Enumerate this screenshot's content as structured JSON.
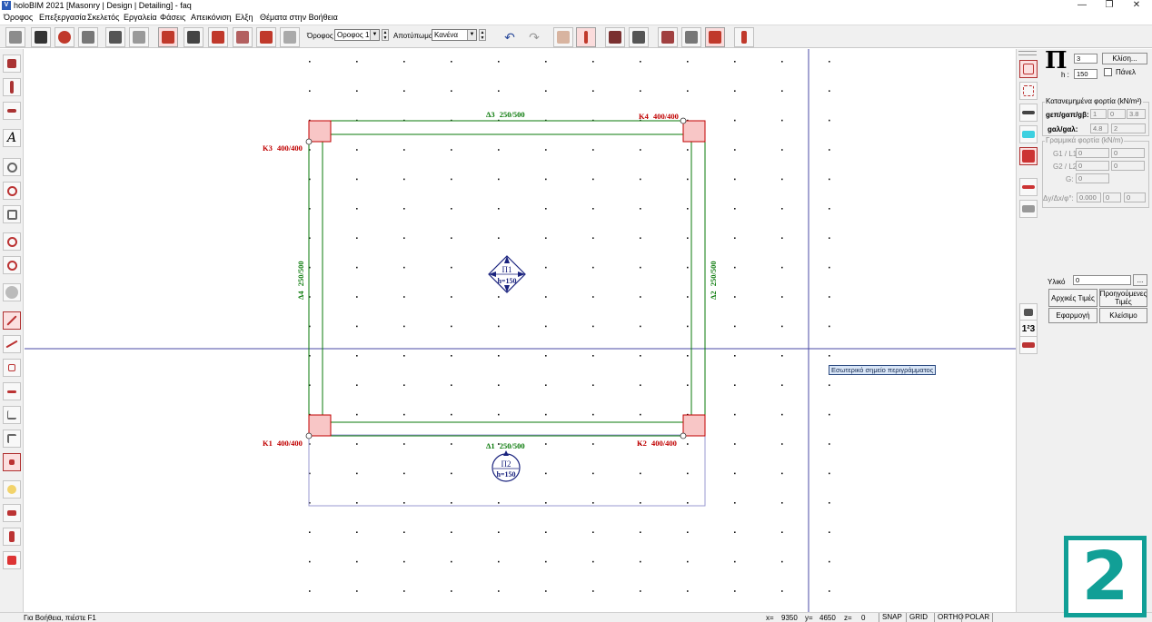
{
  "window": {
    "title": "holoBIM 2021 [Masonry | Design | Detailing] - faq",
    "app_icon": "V",
    "minimize": "—",
    "restore": "❐",
    "close": "✕"
  },
  "menu": [
    "Όροφος",
    "Επεξεργασία",
    "Σκελετός",
    "Εργαλεία",
    "Φάσεις",
    "Απεικόνιση",
    "Ελξη",
    "Θέματα στην Βοήθεια"
  ],
  "toolbar": {
    "floor_label": "Όροφος",
    "floor_value": "Οροφος 1",
    "imprint_label": "Αποτύπωμα",
    "imprint_value": "Κανένα",
    "undo_glyph": "↶",
    "redo_glyph": "↷",
    "colors": {
      "pressed": "#fbdcdc",
      "red_tool": "#c0392b",
      "dark_tool": "#333333",
      "gray_tool": "#8c8c8c"
    }
  },
  "drawing": {
    "colors": {
      "column": "#c00000",
      "beam": "#0a7a0a",
      "slab": "#1a237e",
      "crosshair": "#4a4aa6",
      "column_fill": "#f8c6c6"
    },
    "columns": [
      {
        "label": "K3",
        "section": "400/400"
      },
      {
        "label": "K4",
        "section": "400/400"
      },
      {
        "label": "K1",
        "section": "400/400"
      },
      {
        "label": "K2",
        "section": "400/400"
      }
    ],
    "beams": [
      {
        "label": "Δ3",
        "section": "250/500"
      },
      {
        "label": "Δ1",
        "section": "250/500"
      },
      {
        "label": "Δ4",
        "section": "250/500"
      },
      {
        "label": "Δ2",
        "section": "250/500"
      }
    ],
    "slabs": [
      {
        "label": "Π1",
        "height": "h=150"
      },
      {
        "label": "Π2",
        "height": "h=150"
      }
    ],
    "tooltip": "Εσωτερικό σημείο περιγράμματος"
  },
  "panel": {
    "slab_symbol": "Π",
    "number_value": "3",
    "h_label": "h :",
    "h_value": "150",
    "slope_button": "Κλίση...",
    "panel_checkbox_label": "Πάνελ",
    "distributed_title": "Κατανεμημένα φορτία (kN/m²)",
    "row1_label": "gεπ/gαπ/gβ:",
    "row1_values": [
      "1",
      "0",
      "3.8"
    ],
    "row2_label": "gαλ/gαλ:",
    "row2_values": [
      "4.8",
      "2"
    ],
    "linear_title": "Γραμμικά φορτία (kN/m)",
    "g1_label": "G1 / L1:",
    "g1_values": [
      "0",
      "0"
    ],
    "g2_label": "G2 / L2:",
    "g2_values": [
      "0",
      "0"
    ],
    "g_label": "G:",
    "g_value": "0",
    "dy_label": "Δy/Δx/φ°:",
    "dy_values": [
      "0.000",
      "0",
      "0"
    ],
    "material_label": "Υλικό",
    "material_value": "0",
    "material_browse": "...",
    "initial_values_button": "Αρχικές Τιμές",
    "previous_values_button": "Προηγούμενες Τιμές",
    "apply_button": "Εφαρμογή",
    "close_button": "Κλείσιμο",
    "numbering_glyph": "1²3"
  },
  "status": {
    "help_text": "Για Βοήθεια, πιέστε F1",
    "x_label": "x=",
    "x_value": "9350",
    "y_label": "y=",
    "y_value": "4650",
    "z_label": "z=",
    "z_value": "0",
    "toggles": [
      "SNAP",
      "GRID",
      "ORTHO",
      "POLAR"
    ]
  },
  "overlay_number": "2"
}
